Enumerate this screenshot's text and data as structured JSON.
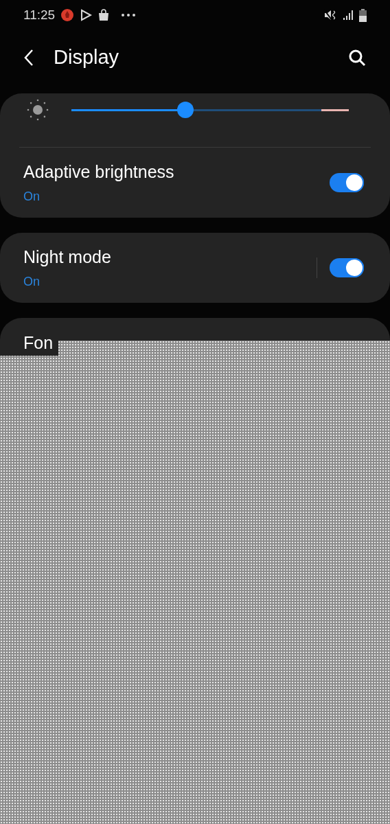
{
  "status_bar": {
    "time": "11:25"
  },
  "header": {
    "title": "Display"
  },
  "brightness": {
    "level": 0.41
  },
  "cards": [
    {
      "items": [
        {
          "title": "Adaptive brightness",
          "status": "On",
          "on": true,
          "separated": false
        }
      ]
    },
    {
      "items": [
        {
          "title": "Night mode",
          "status": "On",
          "on": true,
          "separated": true
        }
      ]
    },
    {
      "items": [
        {
          "title": "Fon"
        }
      ]
    }
  ]
}
